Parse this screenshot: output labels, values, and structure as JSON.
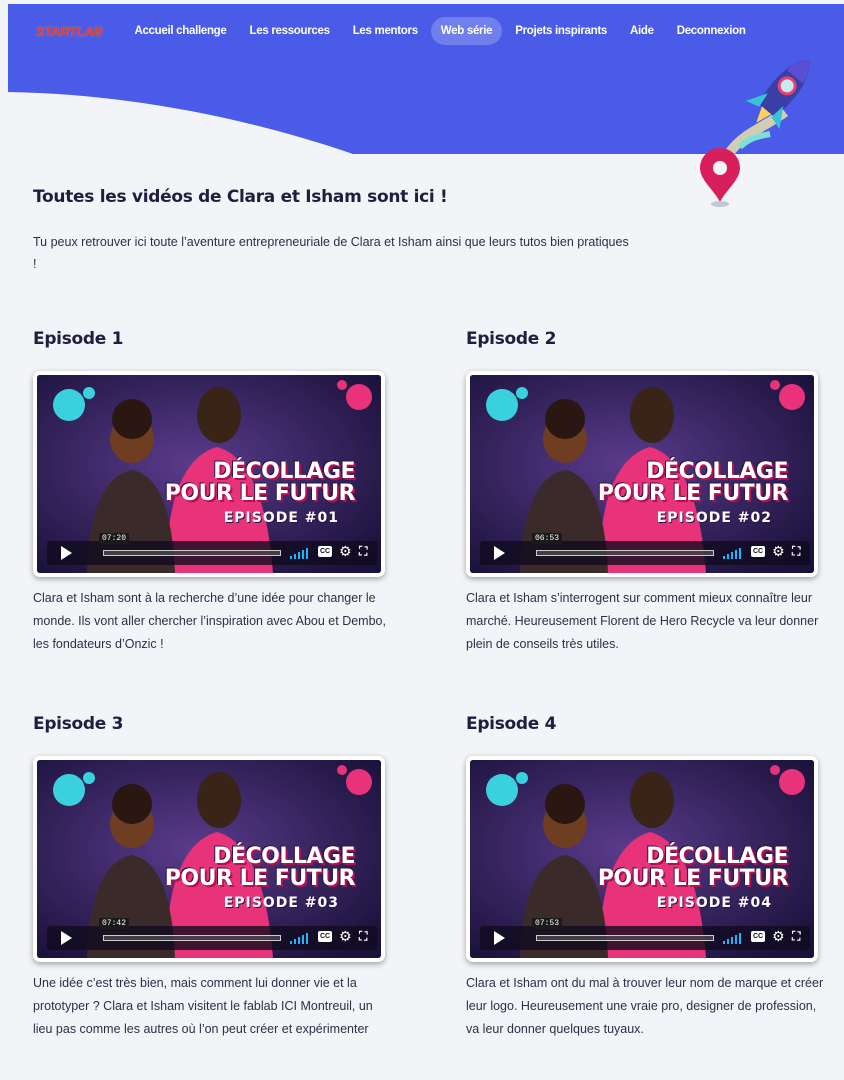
{
  "nav": {
    "logo": "STARTLAB",
    "items": [
      {
        "label": "Accueil challenge",
        "active": false
      },
      {
        "label": "Les ressources",
        "active": false
      },
      {
        "label": "Les mentors",
        "active": false
      },
      {
        "label": "Web série",
        "active": true
      },
      {
        "label": "Projets inspirants",
        "active": false
      },
      {
        "label": "Aide",
        "active": false
      },
      {
        "label": "Deconnexion",
        "active": false
      }
    ]
  },
  "page": {
    "title": "Toutes les vidéos de Clara et Isham sont ici !",
    "intro": "Tu peux retrouver ici toute l’aventure entrepreneuriale de Clara et Isham ainsi que leurs tutos bien pratiques !"
  },
  "episodes": [
    {
      "title": "Episode 1",
      "video": {
        "line1": "DÉCOLLAGE",
        "line2": "POUR LE FUTUR",
        "line3": "EPISODE #01",
        "duration": "07:20",
        "cc": "CC"
      },
      "description": "Clara et Isham sont à la recherche d’une idée pour changer le monde. Ils vont aller chercher l’inspiration avec Abou et Dembo, les fondateurs d’Onzic !"
    },
    {
      "title": "Episode 2",
      "video": {
        "line1": "DÉCOLLAGE",
        "line2": "POUR LE FUTUR",
        "line3": "EPISODE #02",
        "duration": "06:53",
        "cc": "CC"
      },
      "description": "Clara et Isham s’interrogent sur comment mieux connaître leur marché. Heureusement Florent de Hero Recycle va leur donner plein de conseils très utiles."
    },
    {
      "title": "Episode 3",
      "video": {
        "line1": "DÉCOLLAGE",
        "line2": "POUR LE FUTUR",
        "line3": "EPISODE #03",
        "duration": "07:42",
        "cc": "CC"
      },
      "description": "Une idée c’est très bien, mais comment lui donner vie et la prototyper ? Clara et Isham visitent le fablab ICI Montreuil, un lieu pas comme les autres où l’on peut créer et expérimenter"
    },
    {
      "title": "Episode 4",
      "video": {
        "line1": "DÉCOLLAGE",
        "line2": "POUR LE FUTUR",
        "line3": "EPISODE #04",
        "duration": "07:53",
        "cc": "CC"
      },
      "description": "Clara et Isham ont du mal à trouver leur nom de marque et créer leur logo. Heureusement une vraie pro, designer de profession, va leur donner quelques tuyaux."
    }
  ],
  "colors": {
    "header": "#4a5be8",
    "background": "#f2f4f7",
    "brand_red": "#e8333b",
    "title": "#1d1f3f",
    "video_pink": "#e8337a",
    "volume_blue": "#19b7ff"
  },
  "icons": {
    "play": "play-icon",
    "volume": "volume-icon",
    "captions": "cc-icon",
    "settings": "gear-icon",
    "fullscreen": "fullscreen-icon",
    "rocket": "rocket-illustration",
    "pin": "map-pin-illustration"
  }
}
